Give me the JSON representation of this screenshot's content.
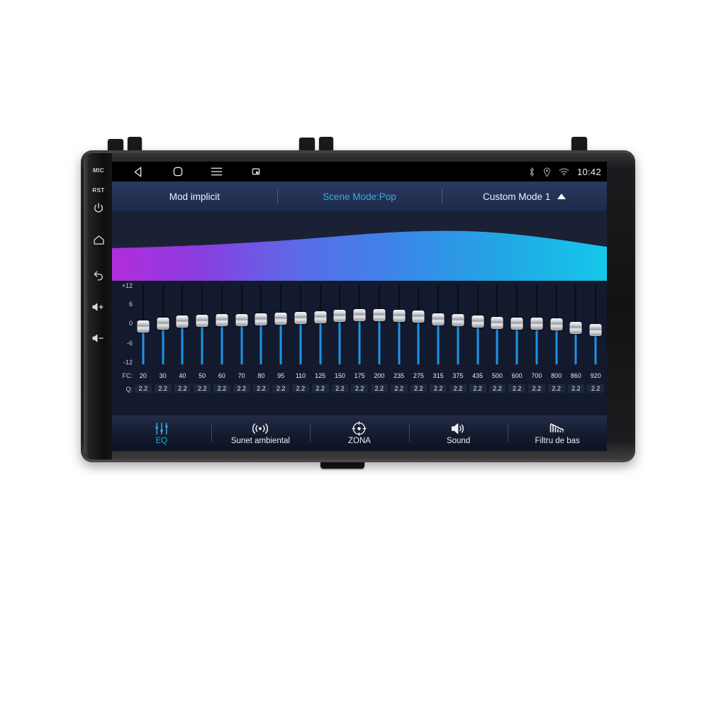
{
  "device": {
    "side_buttons": [
      {
        "name": "mic-label",
        "label": "MIC"
      },
      {
        "name": "rst-label",
        "label": "RST"
      },
      {
        "name": "power-icon",
        "label": ""
      },
      {
        "name": "home-icon",
        "label": ""
      },
      {
        "name": "back-icon",
        "label": ""
      },
      {
        "name": "volume-up-icon",
        "label": ""
      },
      {
        "name": "volume-down-icon",
        "label": ""
      }
    ]
  },
  "statusbar": {
    "nav": [
      {
        "name": "nav-back-icon",
        "label": "back"
      },
      {
        "name": "nav-home-icon",
        "label": "home"
      },
      {
        "name": "nav-menu-icon",
        "label": "menu"
      },
      {
        "name": "nav-screenshot-icon",
        "label": "screenshot"
      }
    ],
    "icons": [
      {
        "name": "bluetooth-icon",
        "label": "bluetooth"
      },
      {
        "name": "location-icon",
        "label": "location"
      },
      {
        "name": "wifi-icon",
        "label": "wifi"
      }
    ],
    "clock": "10:42"
  },
  "modebar": {
    "default_mode": "Mod implicit",
    "scene_mode": "Scene Mode:Pop",
    "custom_mode": "Custom Mode 1"
  },
  "eq": {
    "scale_labels": [
      "+12",
      "6",
      "0",
      "-6",
      "-12"
    ],
    "fc_prefix": "FC:",
    "q_prefix": "Q:",
    "bands": [
      {
        "fc": "20",
        "q": "2.2",
        "gain": -0.6
      },
      {
        "fc": "30",
        "q": "2.2",
        "gain": 0.4
      },
      {
        "fc": "40",
        "q": "2.2",
        "gain": 1.0
      },
      {
        "fc": "50",
        "q": "2.2",
        "gain": 1.2
      },
      {
        "fc": "60",
        "q": "2.2",
        "gain": 1.4
      },
      {
        "fc": "70",
        "q": "2.2",
        "gain": 1.5
      },
      {
        "fc": "80",
        "q": "2.2",
        "gain": 1.6
      },
      {
        "fc": "95",
        "q": "2.2",
        "gain": 1.8
      },
      {
        "fc": "110",
        "q": "2.2",
        "gain": 2.0
      },
      {
        "fc": "125",
        "q": "2.2",
        "gain": 2.2
      },
      {
        "fc": "150",
        "q": "2.2",
        "gain": 2.6
      },
      {
        "fc": "175",
        "q": "2.2",
        "gain": 2.8
      },
      {
        "fc": "200",
        "q": "2.2",
        "gain": 3.0
      },
      {
        "fc": "235",
        "q": "2.2",
        "gain": 2.6
      },
      {
        "fc": "275",
        "q": "2.2",
        "gain": 2.4
      },
      {
        "fc": "315",
        "q": "2.2",
        "gain": 1.6
      },
      {
        "fc": "375",
        "q": "2.2",
        "gain": 1.3
      },
      {
        "fc": "435",
        "q": "2.2",
        "gain": 1.0
      },
      {
        "fc": "500",
        "q": "2.2",
        "gain": 0.5
      },
      {
        "fc": "600",
        "q": "2.2",
        "gain": 0.4
      },
      {
        "fc": "700",
        "q": "2.2",
        "gain": 0.3
      },
      {
        "fc": "800",
        "q": "2.2",
        "gain": 0.1
      },
      {
        "fc": "860",
        "q": "2.2",
        "gain": -1.0
      },
      {
        "fc": "920",
        "q": "2.2",
        "gain": -1.6
      }
    ]
  },
  "bottomnav": {
    "items": [
      {
        "name": "tab-eq",
        "label": "EQ",
        "icon": "equalizer-icon",
        "active": true
      },
      {
        "name": "tab-surround",
        "label": "Sunet ambiental",
        "icon": "surround-sound-icon",
        "active": false
      },
      {
        "name": "tab-zone",
        "label": "ZONA",
        "icon": "zone-target-icon",
        "active": false
      },
      {
        "name": "tab-sound",
        "label": "Sound",
        "icon": "speaker-icon",
        "active": false
      },
      {
        "name": "tab-bass-filter",
        "label": "Filtru de bas",
        "icon": "bass-filter-icon",
        "active": false
      }
    ]
  },
  "colors": {
    "accent": "#2fa3e3",
    "slider_fill": "#1f93e8",
    "wave_start": "#a832d6",
    "wave_mid": "#3f7fe8",
    "wave_end": "#17c4e8",
    "screen_bg": "#131a2e"
  }
}
